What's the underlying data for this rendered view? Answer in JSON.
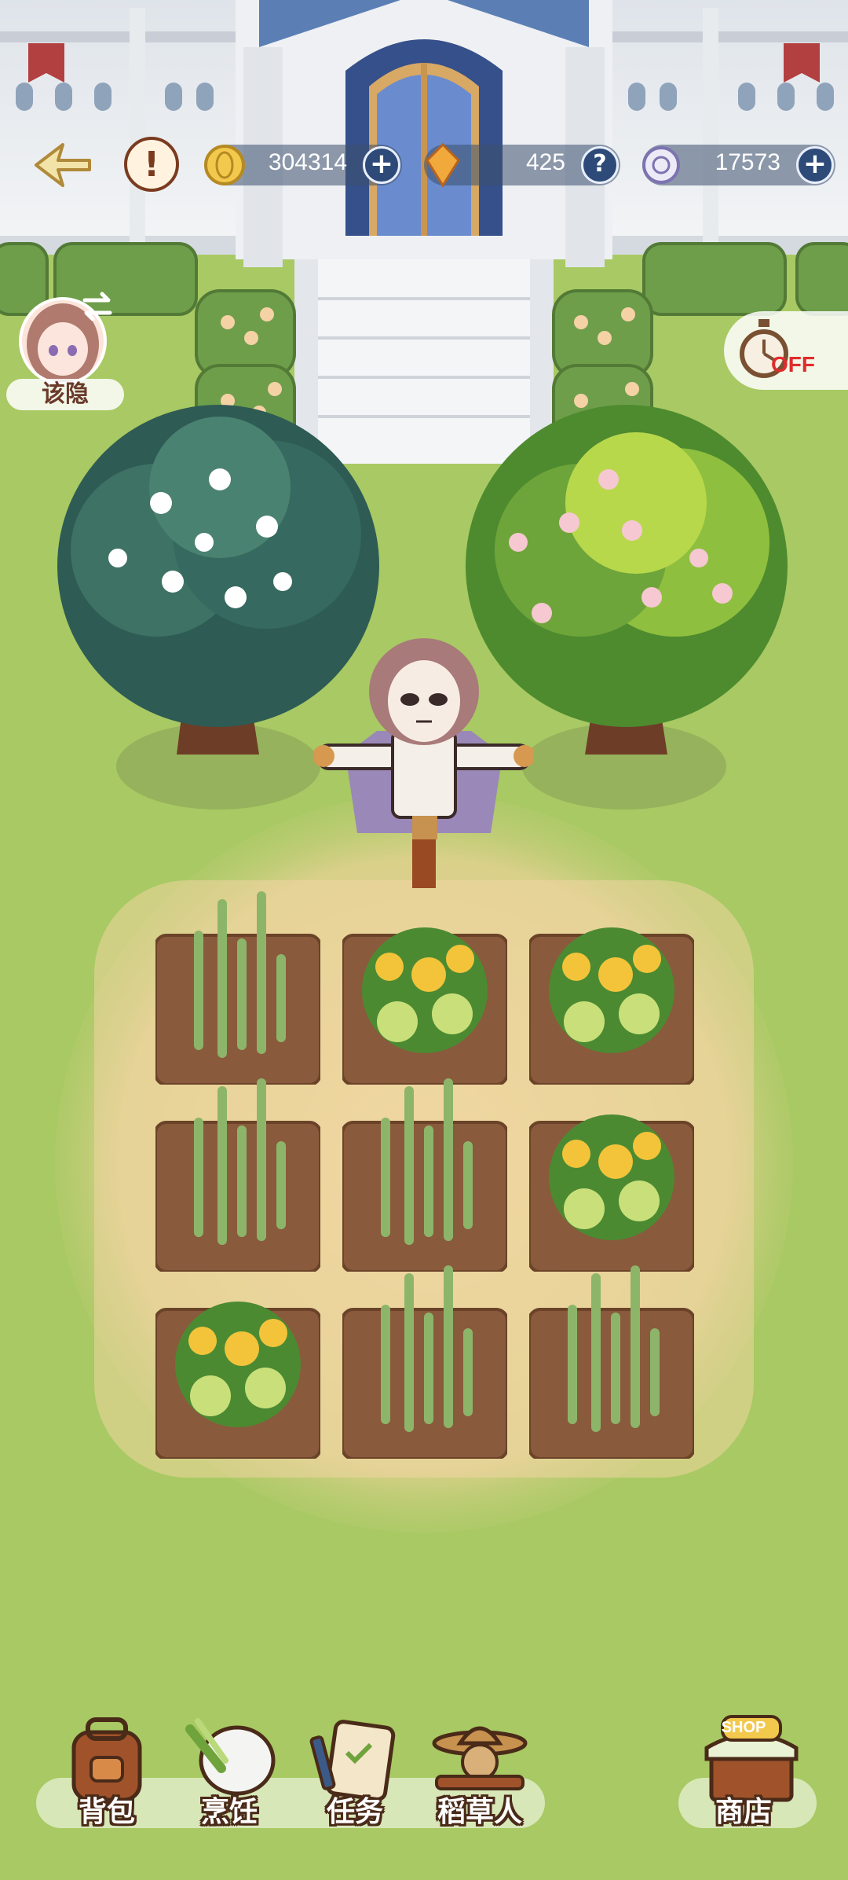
{
  "topbar": {
    "back_icon": "back-arrow-icon",
    "alert_icon": "exclamation-icon",
    "alert_label": "!",
    "gold": {
      "icon": "gold-coin-icon",
      "value": "304314"
    },
    "crystal": {
      "icon": "amber-crystal-icon",
      "value": "425"
    },
    "orb": {
      "icon": "spiral-orb-icon",
      "value": "17573"
    },
    "plus_label": "+",
    "help_label": "?"
  },
  "character": {
    "name": "该隐",
    "swap_icon": "swap-arrows-icon"
  },
  "timer": {
    "icon": "stopwatch-icon",
    "label": "OFF"
  },
  "field": {
    "plots": [
      {
        "crop": "asparagus"
      },
      {
        "crop": "melon"
      },
      {
        "crop": "melon"
      },
      {
        "crop": "asparagus"
      },
      {
        "crop": "asparagus"
      },
      {
        "crop": "melon"
      },
      {
        "crop": "melon"
      },
      {
        "crop": "asparagus"
      },
      {
        "crop": "asparagus"
      }
    ]
  },
  "nav": {
    "backpack": "背包",
    "cooking": "烹饪",
    "tasks": "任务",
    "scarecrow": "稻草人",
    "shop": "商店",
    "shop_sign": "SHOP"
  },
  "colors": {
    "grass": "#a8c963",
    "soil": "#8a5a3c",
    "accent": "#e02c2c"
  }
}
